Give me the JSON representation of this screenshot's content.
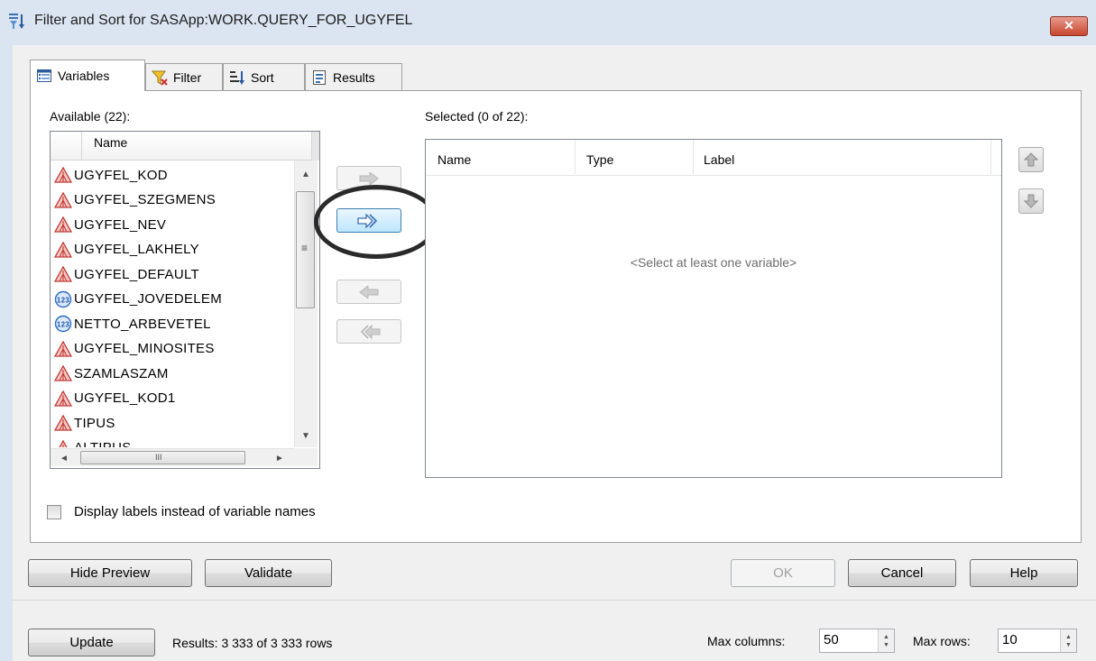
{
  "window": {
    "title": "Filter and Sort for SASApp:WORK.QUERY_FOR_UGYFEL",
    "close_glyph": "✕"
  },
  "tabs": [
    {
      "label": "Variables",
      "icon": "variables-icon",
      "active": true
    },
    {
      "label": "Filter",
      "icon": "filter-funnel-icon",
      "active": false
    },
    {
      "label": "Sort",
      "icon": "sort-icon",
      "active": false
    },
    {
      "label": "Results",
      "icon": "results-icon",
      "active": false
    }
  ],
  "available": {
    "label": "Available (22):",
    "column_header": "Name",
    "items": [
      {
        "name": "UGYFEL_KOD",
        "type": "character"
      },
      {
        "name": "UGYFEL_SZEGMENS",
        "type": "character"
      },
      {
        "name": "UGYFEL_NEV",
        "type": "character"
      },
      {
        "name": "UGYFEL_LAKHELY",
        "type": "character"
      },
      {
        "name": "UGYFEL_DEFAULT",
        "type": "character"
      },
      {
        "name": "UGYFEL_JOVEDELEM",
        "type": "numeric"
      },
      {
        "name": "NETTO_ARBEVETEL",
        "type": "numeric"
      },
      {
        "name": "UGYFEL_MINOSITES",
        "type": "character"
      },
      {
        "name": "SZAMLASZAM",
        "type": "character"
      },
      {
        "name": "UGYFEL_KOD1",
        "type": "character"
      },
      {
        "name": "TIPUS",
        "type": "character"
      },
      {
        "name": "ALTIPUS",
        "type": "character"
      }
    ],
    "scroll_glyphs": {
      "up": "▲",
      "down": "▼",
      "left": "◄",
      "right": "►",
      "grip_v": "≡",
      "grip_h": "III"
    }
  },
  "move_buttons": {
    "add_one": "⇨",
    "add_all": "⇛",
    "remove_one": "⇦",
    "remove_all": "⇚"
  },
  "selected": {
    "label": "Selected (0 of 22):",
    "columns": [
      "Name",
      "Type",
      "Label"
    ],
    "empty_message": "<Select at least one variable>"
  },
  "display_labels_checkbox": {
    "label": "Display labels instead of variable names",
    "checked": false
  },
  "buttons": {
    "hide_preview": "Hide Preview",
    "validate": "Validate",
    "ok": "OK",
    "cancel": "Cancel",
    "help": "Help",
    "update": "Update"
  },
  "status": {
    "results": "Results:  3 333 of 3 333 rows"
  },
  "limits": {
    "max_columns_label": "Max columns:",
    "max_columns_value": "50",
    "max_rows_label": "Max rows:",
    "max_rows_value": "10"
  },
  "colors": {
    "title_bar": "#dbe5f1",
    "close_button": "#c8462f",
    "character_icon": "#d9534f",
    "numeric_icon": "#3b7fd4"
  }
}
